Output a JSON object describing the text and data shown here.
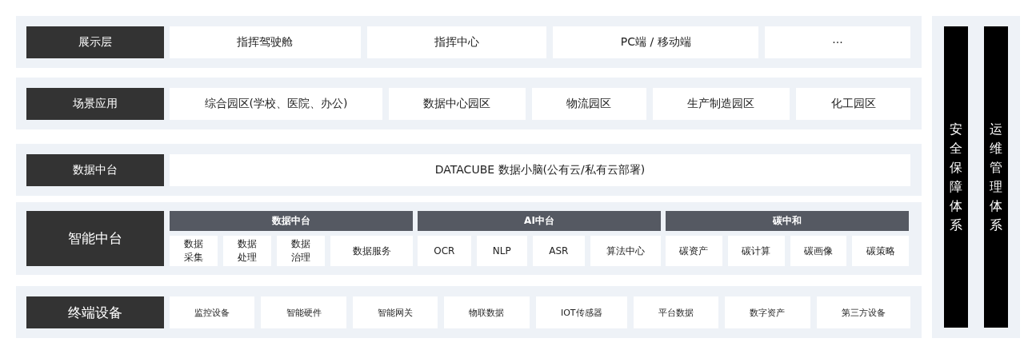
{
  "layers": [
    {
      "kind": "row",
      "label": "展示层",
      "items": [
        "指挥驾驶舱",
        "指挥中心",
        "PC端 / 移动端",
        "···"
      ]
    },
    {
      "kind": "row",
      "label": "场景应用",
      "items": [
        "综合园区(学校、医院、办公)",
        "数据中心园区",
        "物流园区",
        "生产制造园区",
        "化工园区"
      ]
    },
    {
      "kind": "row",
      "label": "数据中台",
      "items": [
        "DATACUBE 数据小脑(公有云/私有云部署)"
      ]
    },
    {
      "kind": "groups",
      "label": "智能中台",
      "groups": [
        {
          "title": "数据中台",
          "items": [
            {
              "text": "数据采集",
              "wrap": true
            },
            {
              "text": "数据处理",
              "wrap": true
            },
            {
              "text": "数据治理",
              "wrap": true
            },
            {
              "text": "数据服务",
              "wrap": false
            }
          ]
        },
        {
          "title": "AI中台",
          "items": [
            {
              "text": "OCR",
              "wrap": false
            },
            {
              "text": "NLP",
              "wrap": false
            },
            {
              "text": "ASR",
              "wrap": false
            },
            {
              "text": "算法中心",
              "wrap": false
            }
          ]
        },
        {
          "title": "碳中和",
          "items": [
            {
              "text": "碳资产",
              "wrap": false
            },
            {
              "text": "碳计算",
              "wrap": false
            },
            {
              "text": "碳画像",
              "wrap": false
            },
            {
              "text": "碳策略",
              "wrap": false
            }
          ]
        }
      ]
    },
    {
      "kind": "devices",
      "label": "终端设备",
      "items": [
        "监控设备",
        "智能硬件",
        "智能网关",
        "物联数据",
        "IOT传感器",
        "平台数据",
        "数字资产",
        "第三方设备"
      ]
    }
  ],
  "side_systems": [
    "安全保障体系",
    "运维管理体系"
  ]
}
